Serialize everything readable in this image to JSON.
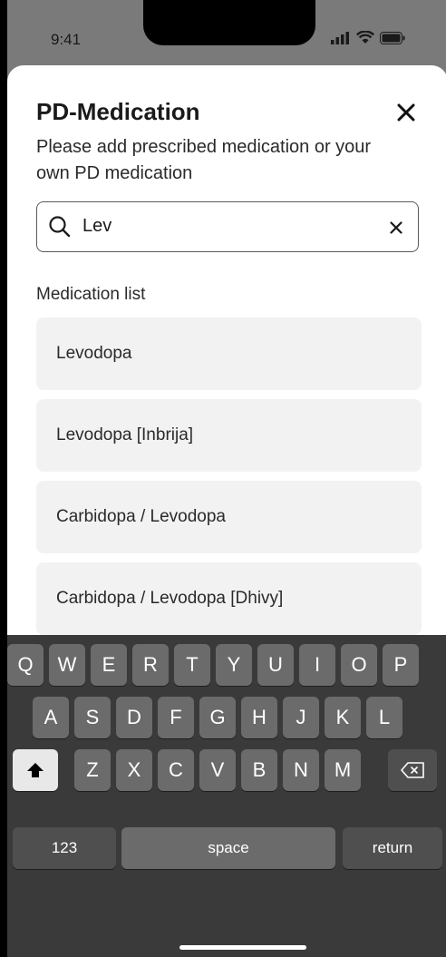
{
  "status_bar": {
    "time": "9:41"
  },
  "sheet": {
    "title": "PD-Medication",
    "subtitle": "Please add prescribed medication or your own PD medication",
    "search": {
      "value": "Lev",
      "placeholder": ""
    },
    "list_heading": "Medication list",
    "medications": [
      {
        "label": "Levodopa"
      },
      {
        "label": "Levodopa [Inbrija]"
      },
      {
        "label": "Carbidopa / Levodopa"
      },
      {
        "label": "Carbidopa / Levodopa [Dhivy]"
      }
    ]
  },
  "keyboard": {
    "row1": [
      "Q",
      "W",
      "E",
      "R",
      "T",
      "Y",
      "U",
      "I",
      "O",
      "P"
    ],
    "row2": [
      "A",
      "S",
      "D",
      "F",
      "G",
      "H",
      "J",
      "K",
      "L"
    ],
    "row3": [
      "Z",
      "X",
      "C",
      "V",
      "B",
      "N",
      "M"
    ],
    "numbers_label": "123",
    "space_label": "space",
    "return_label": "return"
  },
  "icons": {
    "signal": "signal-icon",
    "wifi": "wifi-icon",
    "battery": "battery-icon",
    "close": "close-icon",
    "search": "search-icon",
    "clear": "clear-icon",
    "shift": "shift-icon",
    "backspace": "backspace-icon"
  },
  "colors": {
    "keyboard_bg": "#3a3a3a",
    "key_bg": "#6b6b6b",
    "sheet_bg": "#ffffff",
    "list_item_bg": "#f2f2f2",
    "backdrop": "#7a7a7a"
  }
}
